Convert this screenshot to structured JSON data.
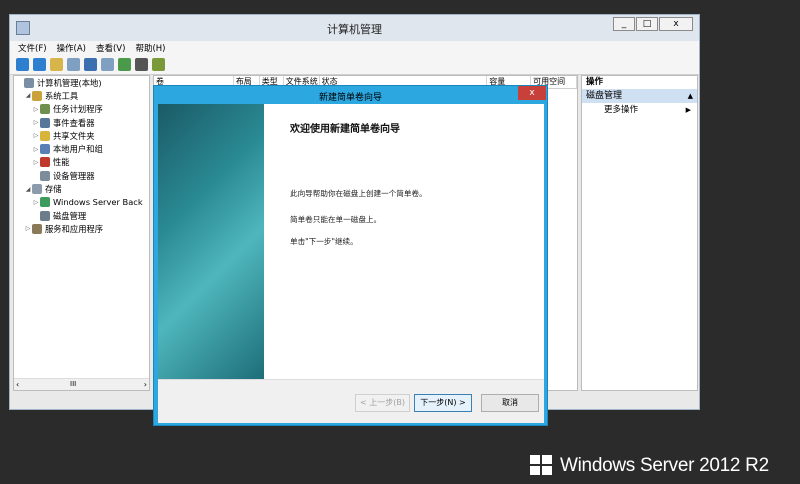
{
  "window": {
    "title": "计算机管理",
    "controls": {
      "minimize": "_",
      "maximize": "□",
      "close": "x"
    }
  },
  "menu": [
    "文件(F)",
    "操作(A)",
    "查看(V)",
    "帮助(H)"
  ],
  "tree": [
    {
      "label": "计算机管理(本地)",
      "indent": 0,
      "arrow": "",
      "icon": "computer-management-icon",
      "color": "#7a8fa6"
    },
    {
      "label": "系统工具",
      "indent": 1,
      "arrow": "◢",
      "icon": "system-tools-icon",
      "color": "#c9a23a"
    },
    {
      "label": "任务计划程序",
      "indent": 2,
      "arrow": "▷",
      "icon": "task-scheduler-icon",
      "color": "#6f8f4e"
    },
    {
      "label": "事件查看器",
      "indent": 2,
      "arrow": "▷",
      "icon": "event-viewer-icon",
      "color": "#557799"
    },
    {
      "label": "共享文件夹",
      "indent": 2,
      "arrow": "▷",
      "icon": "shared-folders-icon",
      "color": "#d9b43c"
    },
    {
      "label": "本地用户和组",
      "indent": 2,
      "arrow": "▷",
      "icon": "users-groups-icon",
      "color": "#5a7fb5"
    },
    {
      "label": "性能",
      "indent": 2,
      "arrow": "▷",
      "icon": "performance-icon",
      "color": "#c0392b"
    },
    {
      "label": "设备管理器",
      "indent": 2,
      "arrow": "",
      "icon": "device-manager-icon",
      "color": "#7c8c9c"
    },
    {
      "label": "存储",
      "indent": 1,
      "arrow": "◢",
      "icon": "storage-icon",
      "color": "#8b9bab"
    },
    {
      "label": "Windows Server Back",
      "indent": 2,
      "arrow": "▷",
      "icon": "windows-backup-icon",
      "color": "#3c9c5c"
    },
    {
      "label": "磁盘管理",
      "indent": 2,
      "arrow": "",
      "icon": "disk-management-icon",
      "color": "#6c7c8c"
    },
    {
      "label": "服务和应用程序",
      "indent": 1,
      "arrow": "▷",
      "icon": "services-apps-icon",
      "color": "#8a7a5a"
    }
  ],
  "tree_scroll": {
    "left": "‹",
    "middle": "III",
    "right": "›"
  },
  "columns": [
    "卷",
    "布局",
    "类型",
    "文件系统",
    "状态",
    "容量",
    "可用空间"
  ],
  "actions": {
    "header": "操作",
    "section": "磁盘管理",
    "more": "更多操作"
  },
  "wizard": {
    "title": "新建简单卷向导",
    "close": "x",
    "heading": "欢迎使用新建简单卷向导",
    "para1": "此向导帮助你在磁盘上创建一个简单卷。",
    "para2": "简单卷只能在单一磁盘上。",
    "para3": "单击\"下一步\"继续。",
    "back": "< 上一步(B)",
    "next": "下一步(N) >",
    "cancel": "取消"
  },
  "brand": {
    "name": "Windows Server 2012 R2"
  }
}
